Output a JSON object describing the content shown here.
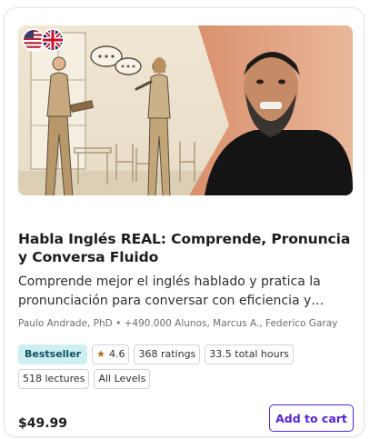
{
  "course": {
    "title": "Habla Inglés REAL: Comprende, Pronuncia y Conversa Fluido",
    "subtitle": "Comprende mejor el inglés hablado y pratica la pronunciación para conversar con eficiencia y confianza.",
    "instructors": "Paulo Andrade, PhD • +490.000 Alunos, Marcus A., Federico Garay",
    "badge": "Bestseller",
    "rating": "4.6",
    "ratings_count": "368 ratings",
    "total_hours": "33.5 total hours",
    "lectures": "518 lectures",
    "level": "All Levels",
    "price": "$49.99",
    "add_to_cart_label": "Add to cart"
  },
  "icons": {
    "flags": [
      "us-flag-icon",
      "uk-flag-icon"
    ],
    "star": "star-icon"
  },
  "colors": {
    "brand_purple": "#5624d0",
    "badge_bg": "#cdeff1",
    "badge_text": "#0d5261",
    "star": "#b4690e"
  }
}
